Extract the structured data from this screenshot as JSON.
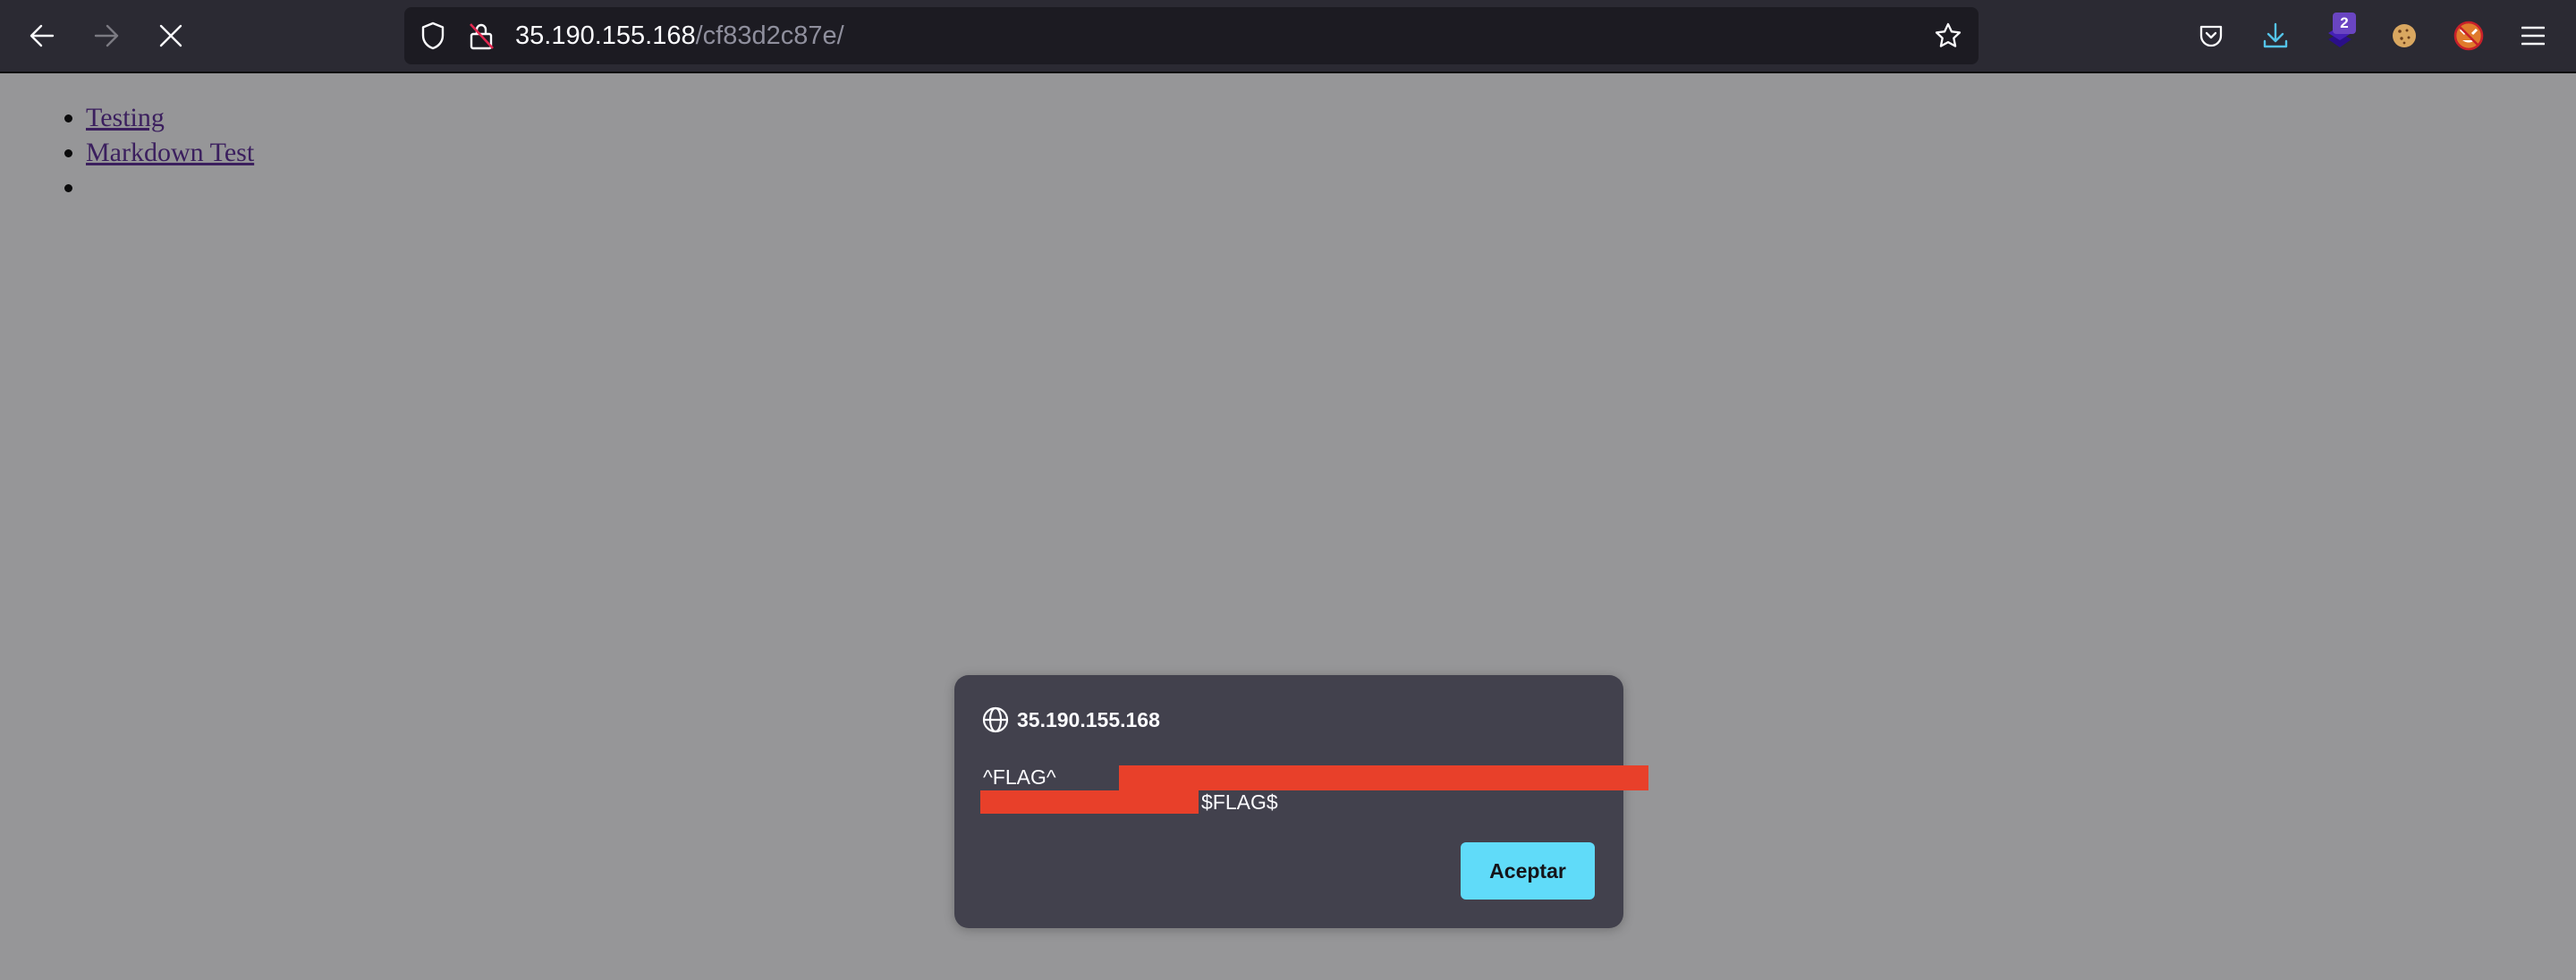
{
  "browser": {
    "nav": {
      "back_icon": "arrow-left-icon",
      "forward_icon": "arrow-right-icon",
      "stop_icon": "close-icon"
    },
    "urlbar": {
      "tracking_icon": "shield-icon",
      "security_icon": "insecure-lock-icon",
      "host": "35.190.155.168",
      "path": "/cf83d2c87e/",
      "bookmark_icon": "star-icon"
    },
    "toolbar_icons": {
      "pocket": "pocket-icon",
      "downloads": "download-icon",
      "extension_layers": "layers-extension-icon",
      "extension_badge": "2",
      "cookie_extension": "cookie-icon",
      "fox_extension": "blocked-fox-icon",
      "menu": "hamburger-menu-icon"
    },
    "colors": {
      "toolbar": "#2b2a33",
      "urlbar": "#1c1b22",
      "dialog": "#42414d",
      "accent_button": "#60dbf9",
      "redaction": "#e8402a",
      "download_icon": "#54c3e8",
      "badge": "#6a45c2"
    }
  },
  "page": {
    "links": [
      {
        "label": "Testing"
      },
      {
        "label": "Markdown Test"
      },
      {
        "label": ""
      }
    ]
  },
  "dialog": {
    "host_icon": "globe-icon",
    "host": "35.190.155.168",
    "message_prefix": "^FLAG^",
    "message_suffix": "$FLAG$",
    "message_redacted": true,
    "confirm_label": "Aceptar"
  }
}
